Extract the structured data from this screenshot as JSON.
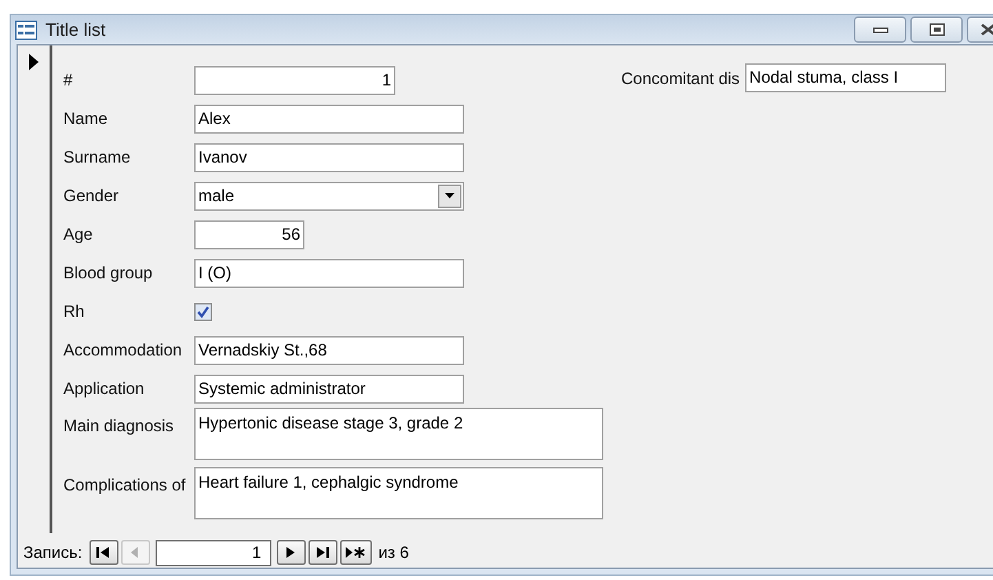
{
  "window": {
    "title": "Title list"
  },
  "fields": [
    {
      "label": "#",
      "kind": "number",
      "value": "1"
    },
    {
      "label": "Name",
      "kind": "text",
      "value": "Alex"
    },
    {
      "label": "Surname",
      "kind": "text",
      "value": "Ivanov"
    },
    {
      "label": "Gender",
      "kind": "combo",
      "value": "male"
    },
    {
      "label": "Age",
      "kind": "number",
      "value": "56"
    },
    {
      "label": "Blood group",
      "kind": "text",
      "value": "I (O)"
    },
    {
      "label": "Rh",
      "kind": "checkbox",
      "checked": true
    },
    {
      "label": "Accommodation",
      "kind": "text",
      "value": "Vernadskiy St.,68"
    },
    {
      "label": "Application",
      "kind": "short",
      "value": "Systemic administrator"
    },
    {
      "label": "Main diagnosis",
      "kind": "memo",
      "value": "Hypertonic disease stage 3, grade 2"
    },
    {
      "label": "Complications of",
      "kind": "memo",
      "value": "Heart failure 1, cephalgic syndrome"
    }
  ],
  "side_field": {
    "label": "Concomitant dis",
    "value": "Nodal stuma, class I"
  },
  "navigation": {
    "label": "Запись:",
    "current": "1",
    "total": "из 6",
    "buttons": [
      {
        "kind": "first",
        "disabled": false
      },
      {
        "kind": "prev",
        "disabled": true
      },
      {
        "kind": "next",
        "disabled": false
      },
      {
        "kind": "last",
        "disabled": false
      },
      {
        "kind": "new",
        "disabled": false
      }
    ]
  }
}
